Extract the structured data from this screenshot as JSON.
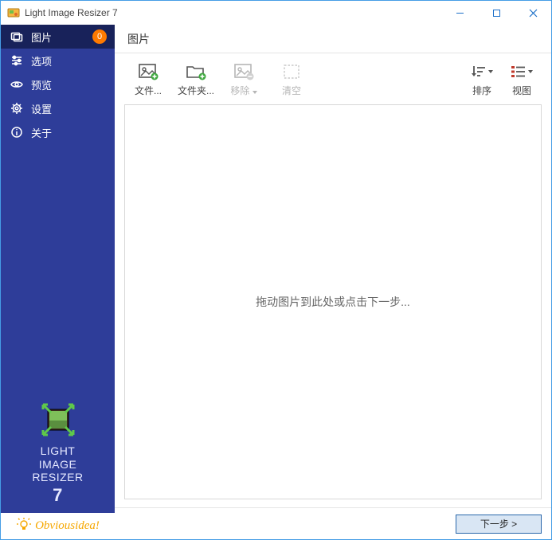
{
  "window": {
    "title": "Light Image Resizer 7"
  },
  "sidebar": {
    "items": [
      {
        "label": "图片",
        "icon": "images-icon",
        "active": true,
        "badge": "0"
      },
      {
        "label": "选项",
        "icon": "sliders-icon"
      },
      {
        "label": "预览",
        "icon": "eye-icon"
      },
      {
        "label": "设置",
        "icon": "gear-icon"
      },
      {
        "label": "关于",
        "icon": "info-icon"
      }
    ],
    "product_name_1": "LIGHT",
    "product_name_2": "IMAGE",
    "product_name_3": "RESIZER",
    "product_version": "7",
    "brand": "Obviousidea!"
  },
  "main": {
    "header": "图片",
    "toolbar": {
      "files": "文件...",
      "folder": "文件夹...",
      "remove": "移除",
      "clear": "清空",
      "sort": "排序",
      "view": "视图"
    },
    "drop_hint": "拖动图片到此处或点击下一步...",
    "next_label": "下一步 >"
  }
}
